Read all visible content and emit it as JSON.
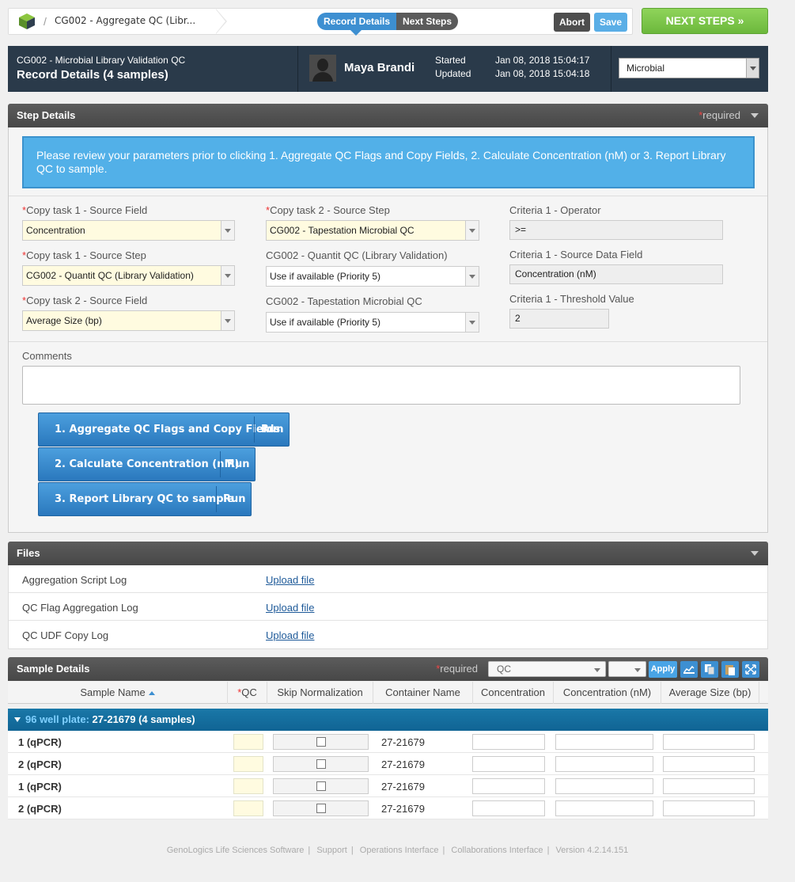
{
  "topbar": {
    "breadcrumb": "CG002 - Aggregate QC (Libr...",
    "tab_record": "Record Details",
    "tab_next": "Next Steps",
    "abort": "Abort",
    "save": "Save",
    "next_steps": "NEXT STEPS »"
  },
  "header": {
    "subtitle": "CG002 - Microbial Library Validation QC",
    "title": "Record Details (4 samples)",
    "user": "Maya Brandi",
    "started_label": "Started",
    "updated_label": "Updated",
    "started_value": "Jan 08, 2018 15:04:17",
    "updated_value": "Jan 08, 2018 15:04:18",
    "select_value": "Microbial"
  },
  "step_details": {
    "title": "Step Details",
    "required_mark": "*",
    "required_text": "required",
    "info": "Please review your parameters prior to clicking 1. Aggregate QC Flags and Copy Fields, 2. Calculate Concentration (nM) or 3. Report Library QC to sample.",
    "fields": {
      "copy1_field_label": "Copy task 1 - Source Field",
      "copy1_field_value": "Concentration",
      "copy1_step_label": "Copy task 1 - Source Step",
      "copy1_step_value": "CG002 - Quantit QC (Library Validation)",
      "copy2_field_label": "Copy task 2 - Source Field",
      "copy2_field_value": "Average Size (bp)",
      "copy2_step_label": "Copy task 2 - Source Step",
      "copy2_step_value": "CG002 - Tapestation Microbial QC",
      "quantit_label": "CG002 - Quantit QC (Library Validation)",
      "quantit_value": "Use if available (Priority 5)",
      "tape_label": "CG002 - Tapestation Microbial QC",
      "tape_value": "Use if available (Priority 5)",
      "crit_op_label": "Criteria 1 - Operator",
      "crit_op_value": ">=",
      "crit_src_label": "Criteria 1 - Source Data Field",
      "crit_src_value": "Concentration (nM)",
      "crit_thr_label": "Criteria 1 - Threshold Value",
      "crit_thr_value": "2"
    },
    "comments_label": "Comments",
    "buttons": [
      {
        "label": "1. Aggregate QC Flags and Copy Fields",
        "run": "Run"
      },
      {
        "label": "2. Calculate Concentration (nM)",
        "run": "Run"
      },
      {
        "label": "3. Report Library QC to sample",
        "run": "Run"
      }
    ]
  },
  "files": {
    "title": "Files",
    "rows": [
      {
        "name": "Aggregation Script Log",
        "action": "Upload file"
      },
      {
        "name": "QC Flag Aggregation Log",
        "action": "Upload file"
      },
      {
        "name": "QC UDF Copy Log",
        "action": "Upload file"
      }
    ]
  },
  "sample_details": {
    "title": "Sample Details",
    "required_mark": "*",
    "required_text": "required",
    "field_select": "QC",
    "apply": "Apply",
    "columns": [
      "Sample Name",
      "QC",
      "Skip Normalization",
      "Container Name",
      "Concentration",
      "Concentration (nM)",
      "Average Size (bp)"
    ],
    "qc_required_mark": "*",
    "group": {
      "prefix": "96 well plate:",
      "name": "27-21679 (4 samples)"
    },
    "rows": [
      {
        "sample": "1 (qPCR)",
        "container": "27-21679"
      },
      {
        "sample": "2 (qPCR)",
        "container": "27-21679"
      },
      {
        "sample": "1 (qPCR)",
        "container": "27-21679"
      },
      {
        "sample": "2 (qPCR)",
        "container": "27-21679"
      }
    ]
  },
  "footer": {
    "links": [
      "GenoLogics Life Sciences Software",
      "Support",
      "Operations Interface",
      "Collaborations Interface",
      "Version 4.2.14.151"
    ]
  }
}
